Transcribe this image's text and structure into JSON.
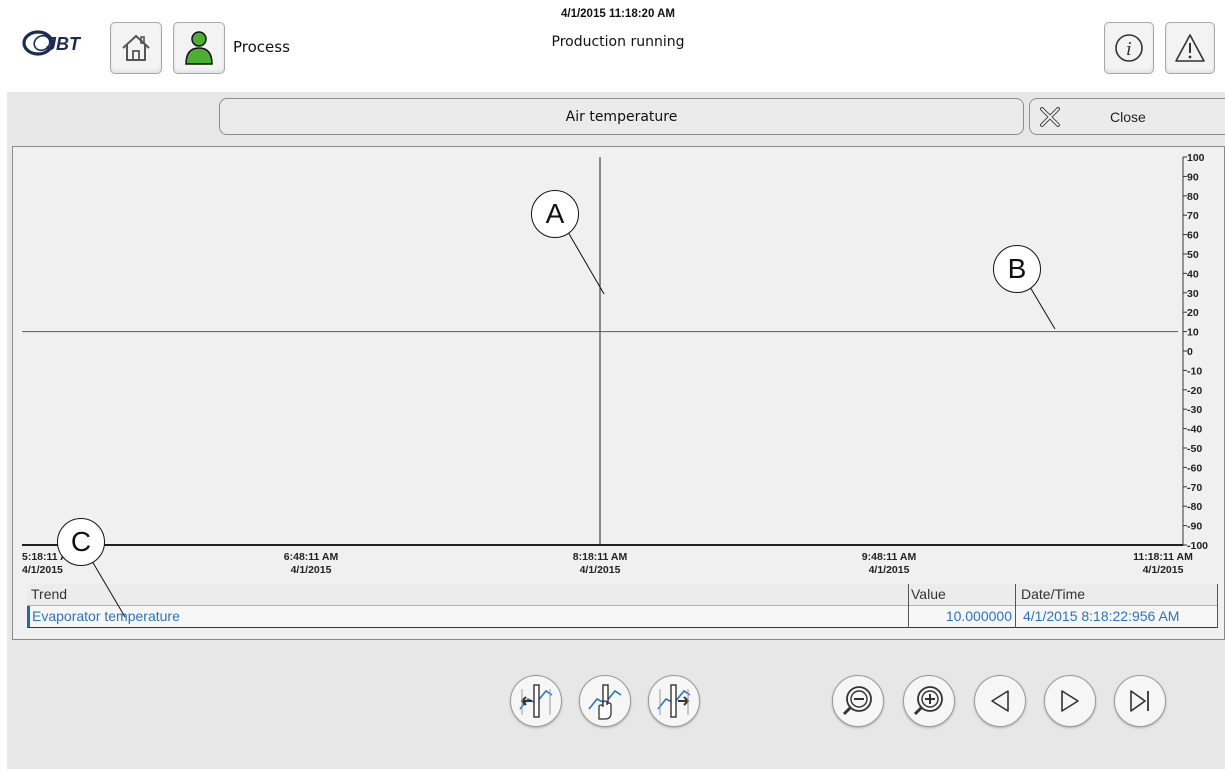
{
  "header": {
    "datetime": "4/1/2015 11:18:20 AM",
    "status": "Production running",
    "process_label": "Process",
    "logo_text": "JBT"
  },
  "icons": {
    "home": "home-icon",
    "user": "user-icon",
    "info": "info-icon",
    "alarm": "alarm-icon",
    "close": "close-icon"
  },
  "title_bar": {
    "title": "Air temperature",
    "close_label": "Close"
  },
  "chart_data": {
    "type": "line",
    "title": "",
    "x_ticks": [
      {
        "time": "5:18:11 AM",
        "date": "4/1/2015"
      },
      {
        "time": "6:48:11 AM",
        "date": "4/1/2015"
      },
      {
        "time": "8:18:11 AM",
        "date": "4/1/2015"
      },
      {
        "time": "9:48:11 AM",
        "date": "4/1/2015"
      },
      {
        "time": "11:18:11 AM",
        "date": "4/1/2015"
      }
    ],
    "xlim": [
      "4/1/2015 5:18:11 AM",
      "4/1/2015 11:18:11 AM"
    ],
    "ylim": [
      -100,
      100
    ],
    "y_ticks": [
      100,
      90,
      80,
      70,
      60,
      50,
      40,
      30,
      20,
      10,
      0,
      -10,
      -20,
      -30,
      -40,
      -50,
      -60,
      -70,
      -80,
      -90,
      -100
    ],
    "y_axis_position": "right",
    "grid": false,
    "series": [
      {
        "name": "Evaporator temperature",
        "color": "#1f67b1",
        "x": [
          "4/1/2015 5:18:11 AM",
          "4/1/2015 11:18:11 AM"
        ],
        "y": [
          10,
          10
        ]
      }
    ],
    "ruler": {
      "x": "4/1/2015 8:18:11 AM"
    }
  },
  "table": {
    "headers": {
      "trend": "Trend",
      "value": "Value",
      "datetime": "Date/Time"
    },
    "rows": [
      {
        "trend": "Evaporator temperature",
        "value": "10.000000",
        "datetime": "4/1/2015 8:18:22:956 AM"
      }
    ]
  },
  "callouts": {
    "a": "A",
    "b": "B",
    "c": "C"
  },
  "toolbar": {
    "buttons": [
      {
        "name": "ruler-back-button",
        "icon": "ruler-back-icon"
      },
      {
        "name": "ruler-hand-button",
        "icon": "ruler-hand-icon"
      },
      {
        "name": "ruler-forward-button",
        "icon": "ruler-forward-icon"
      },
      {
        "name": "zoom-out-button",
        "icon": "zoom-out-icon"
      },
      {
        "name": "zoom-in-button",
        "icon": "zoom-in-icon"
      },
      {
        "name": "scroll-back-button",
        "icon": "triangle-left-icon"
      },
      {
        "name": "scroll-forward-button",
        "icon": "triangle-right-icon"
      },
      {
        "name": "scroll-end-button",
        "icon": "skip-end-icon"
      }
    ]
  },
  "colors": {
    "trend_line": "#1f67b1",
    "user_icon": "#4caf2f",
    "panel_bg": "#e7e7e7"
  }
}
